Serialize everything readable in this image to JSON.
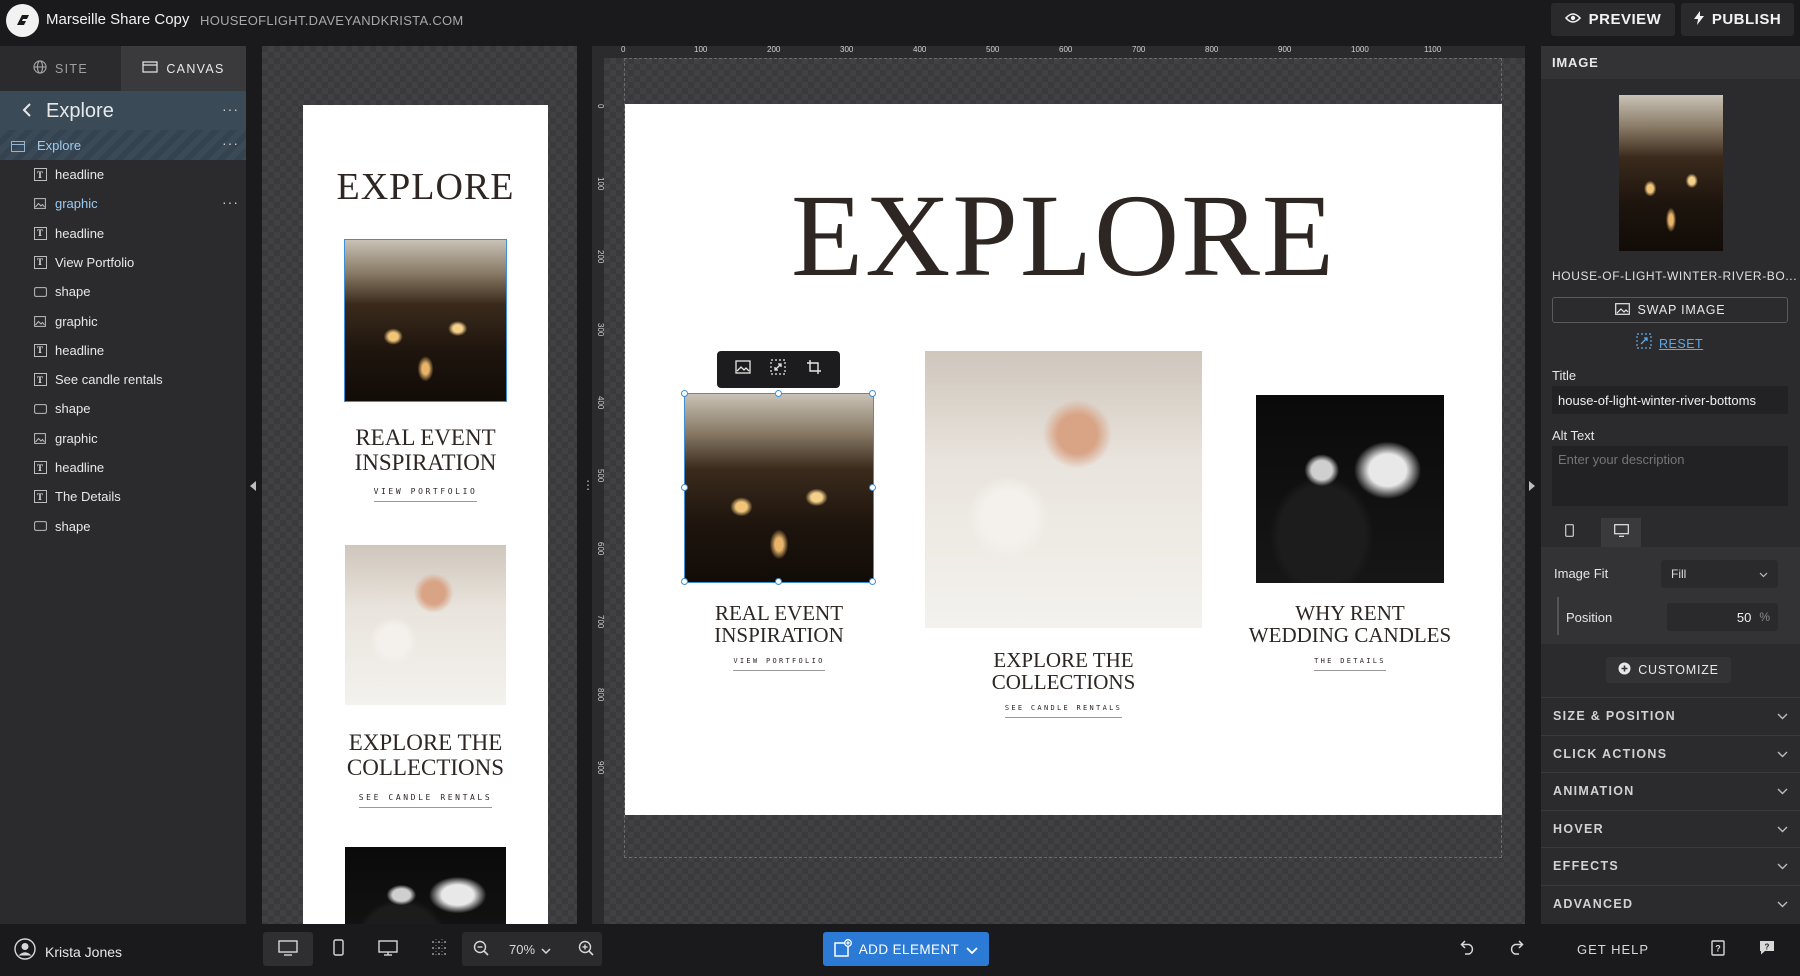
{
  "header": {
    "app_title": "Marseille Share Copy",
    "site_url": "HOUSEOFLIGHT.DAVEYANDKRISTA.COM",
    "preview_label": "PREVIEW",
    "publish_label": "PUBLISH"
  },
  "left_tabs": {
    "site": "SITE",
    "canvas": "CANVAS"
  },
  "layers": {
    "title": "Explore",
    "section": "Explore",
    "items": [
      {
        "type": "text",
        "label": "headline"
      },
      {
        "type": "image",
        "label": "graphic"
      },
      {
        "type": "text",
        "label": "headline"
      },
      {
        "type": "text",
        "label": "View Portfolio"
      },
      {
        "type": "shape",
        "label": "shape"
      },
      {
        "type": "image",
        "label": "graphic"
      },
      {
        "type": "text",
        "label": "headline"
      },
      {
        "type": "text",
        "label": "See candle rentals"
      },
      {
        "type": "shape",
        "label": "shape"
      },
      {
        "type": "image",
        "label": "graphic"
      },
      {
        "type": "text",
        "label": "headline"
      },
      {
        "type": "text",
        "label": "The Details"
      },
      {
        "type": "shape",
        "label": "shape"
      }
    ],
    "dots": "···",
    "type_glyph": "T"
  },
  "mobile_preview": {
    "heading": "EXPLORE",
    "card1_title_l1": "REAL EVENT",
    "card1_title_l2": "INSPIRATION",
    "card1_cta": "VIEW PORTFOLIO",
    "card2_title_l1": "EXPLORE THE",
    "card2_title_l2": "COLLECTIONS",
    "card2_cta": "SEE CANDLE RENTALS"
  },
  "canvas": {
    "heading": "EXPLORE",
    "ruler_top": [
      "0",
      "100",
      "200",
      "300",
      "400",
      "500",
      "600",
      "700",
      "800",
      "900",
      "1000",
      "1100"
    ],
    "ruler_left": [
      "0",
      "100",
      "200",
      "300",
      "400",
      "500",
      "600",
      "700",
      "800",
      "900"
    ],
    "cards": [
      {
        "title_l1": "REAL EVENT",
        "title_l2": "INSPIRATION",
        "cta": "VIEW PORTFOLIO"
      },
      {
        "title_l1": "EXPLORE THE",
        "title_l2": "COLLECTIONS",
        "cta": "SEE CANDLE RENTALS"
      },
      {
        "title_l1": "WHY RENT",
        "title_l2": "WEDDING CANDLES",
        "cta": "THE DETAILS"
      }
    ]
  },
  "inspector": {
    "header": "IMAGE",
    "filename": "HOUSE-OF-LIGHT-WINTER-RIVER-BO...",
    "swap_label": "SWAP IMAGE",
    "reset_label": "RESET",
    "title_label": "Title",
    "title_value": "house-of-light-winter-river-bottoms",
    "alt_label": "Alt Text",
    "alt_placeholder": "Enter your description",
    "image_fit_label": "Image Fit",
    "image_fit_value": "Fill",
    "position_label": "Position",
    "position_value": "50",
    "position_unit": "%",
    "customize_label": "CUSTOMIZE",
    "sections": [
      "SIZE & POSITION",
      "CLICK ACTIONS",
      "ANIMATION",
      "HOVER",
      "EFFECTS",
      "ADVANCED"
    ]
  },
  "footer": {
    "user_name": "Krista Jones",
    "zoom": "70%",
    "add_element_label": "ADD ELEMENT",
    "get_help_label": "GET HELP"
  },
  "colors": {
    "accent": "#2b7bd6",
    "selection": "#3f8fd8",
    "layer_highlight": "#3a4a57",
    "panel": "#2b2b2e"
  }
}
